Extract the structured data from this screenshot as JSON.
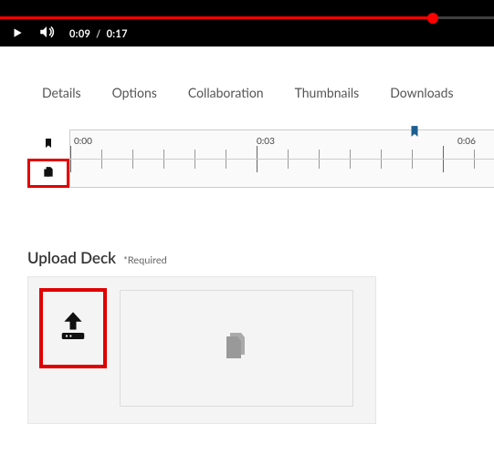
{
  "player": {
    "current_time": "0:09",
    "duration_sep": "/",
    "duration": "0:17"
  },
  "tabs": {
    "details": "Details",
    "options": "Options",
    "collaboration": "Collaboration",
    "thumbnails": "Thumbnails",
    "downloads": "Downloads"
  },
  "timeline": {
    "tick0": "0:00",
    "tick3": "0:03",
    "tick6": "0:06"
  },
  "upload": {
    "title": "Upload Deck",
    "required": "*Required"
  }
}
